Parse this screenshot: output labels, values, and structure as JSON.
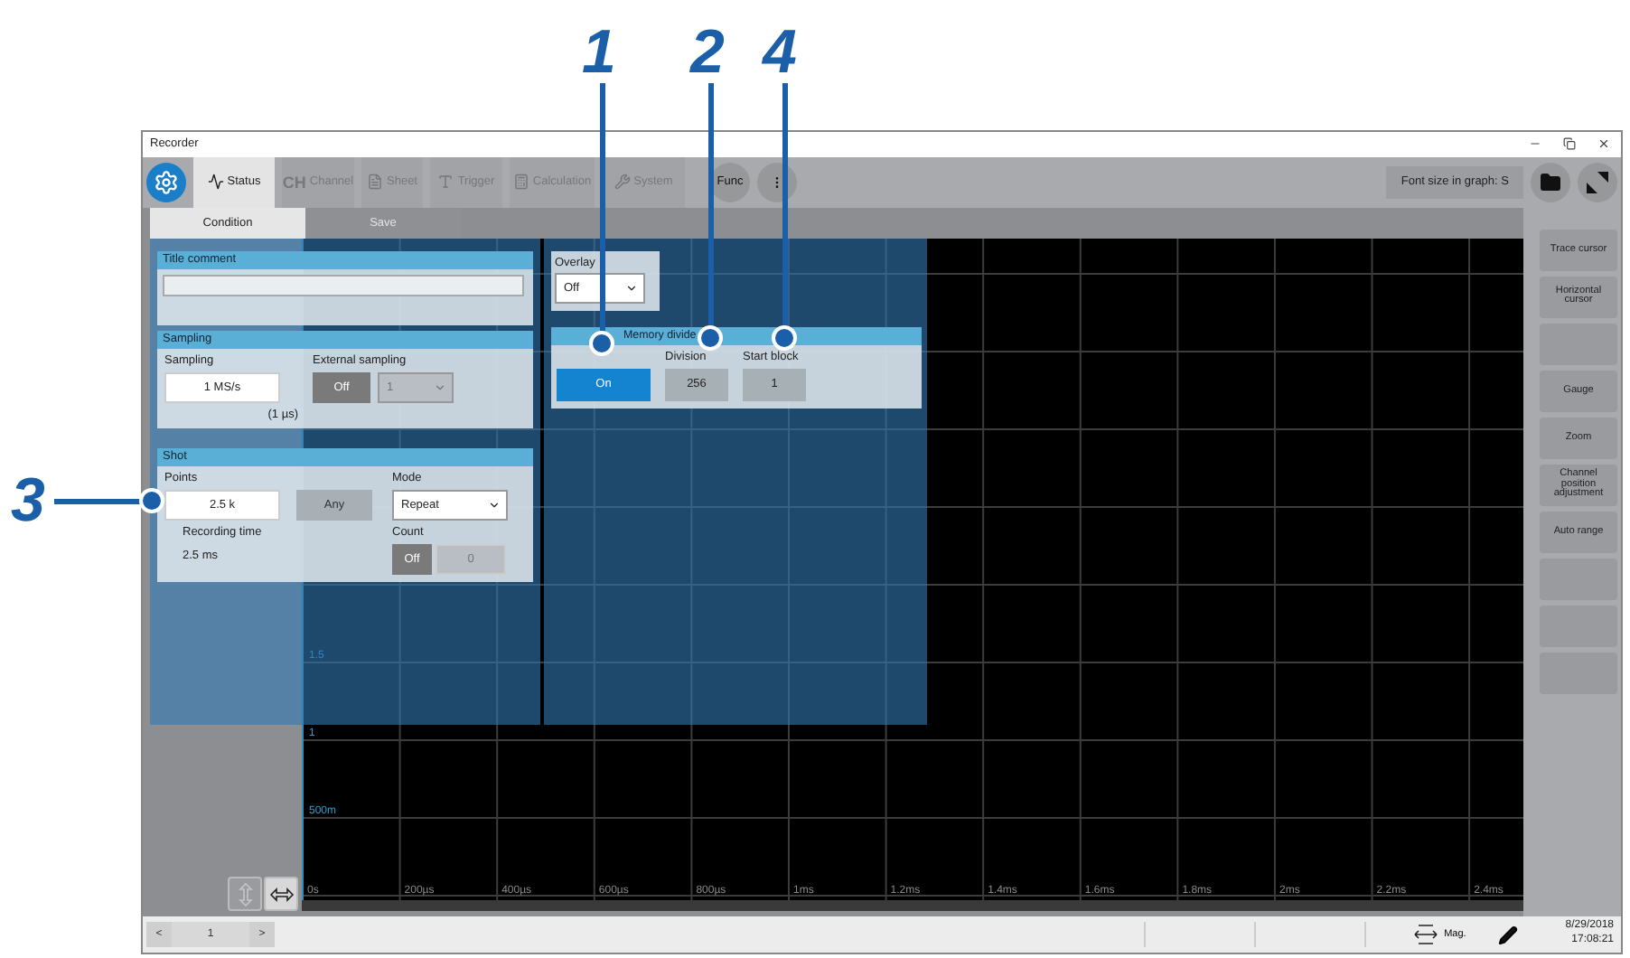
{
  "callouts": [
    {
      "number": "1"
    },
    {
      "number": "2"
    },
    {
      "number": "4"
    },
    {
      "number": "3"
    }
  ],
  "window": {
    "title": "Recorder"
  },
  "toolbar": {
    "tabs": [
      {
        "label": "Status",
        "selected": true,
        "disabled": false
      },
      {
        "label": "Channel",
        "badge": "CH",
        "selected": false,
        "disabled": true
      },
      {
        "label": "Sheet",
        "selected": false,
        "disabled": true
      },
      {
        "label": "Trigger",
        "selected": false,
        "disabled": true
      },
      {
        "label": "Calculation",
        "selected": false,
        "disabled": true
      },
      {
        "label": "System",
        "selected": false,
        "disabled": true
      }
    ],
    "func_button": "Func",
    "font_size": "Font size in graph: S"
  },
  "subtabs": [
    {
      "label": "Condition",
      "selected": true
    },
    {
      "label": "Save",
      "selected": false
    }
  ],
  "title_comment": {
    "title": "Title comment"
  },
  "sampling": {
    "title": "Sampling",
    "sampling_label": "Sampling",
    "sampling_value": "1 MS/s",
    "period": "(1 µs)",
    "external_label": "External sampling",
    "external_state": "Off",
    "external_channel": "1"
  },
  "shot": {
    "title": "Shot",
    "points_label": "Points",
    "points_value": "2.5 k",
    "any_button": "Any",
    "mode_label": "Mode",
    "mode_value": "Repeat",
    "recording_label": "Recording time",
    "recording_value": "2.5 ms",
    "count_label": "Count",
    "count_state": "Off",
    "count_value": "0"
  },
  "overlay": {
    "label": "Overlay",
    "value": "Off"
  },
  "memory_divide": {
    "title": "Memory divide",
    "toggle_label": "On",
    "on": true,
    "division_label": "Division",
    "division": "256",
    "start_label": "Start block",
    "start_block": "1"
  },
  "graph": {
    "y_labels": [
      "1.5",
      "1",
      "500m"
    ],
    "x_labels": [
      "0s",
      "200µs",
      "400µs",
      "600µs",
      "800µs",
      "1ms",
      "1.2ms",
      "1.4ms",
      "1.6ms",
      "1.8ms",
      "2ms",
      "2.2ms",
      "2.4ms"
    ]
  },
  "side_buttons": [
    {
      "kind": "button",
      "label": "Trace cursor"
    },
    {
      "kind": "button",
      "label": "Horizontal cursor"
    },
    {
      "kind": "blank"
    },
    {
      "kind": "button",
      "label": "Gauge"
    },
    {
      "kind": "button",
      "label": "Zoom"
    },
    {
      "kind": "button",
      "label": "Channel position adjustment"
    },
    {
      "kind": "button",
      "label": "Auto range"
    },
    {
      "kind": "blank"
    },
    {
      "kind": "blank"
    },
    {
      "kind": "blank"
    }
  ],
  "status_bar": {
    "prev": "<",
    "page": "1",
    "next": ">",
    "mag": "Mag.",
    "date": "8/29/2018",
    "time": "17:08:21"
  }
}
